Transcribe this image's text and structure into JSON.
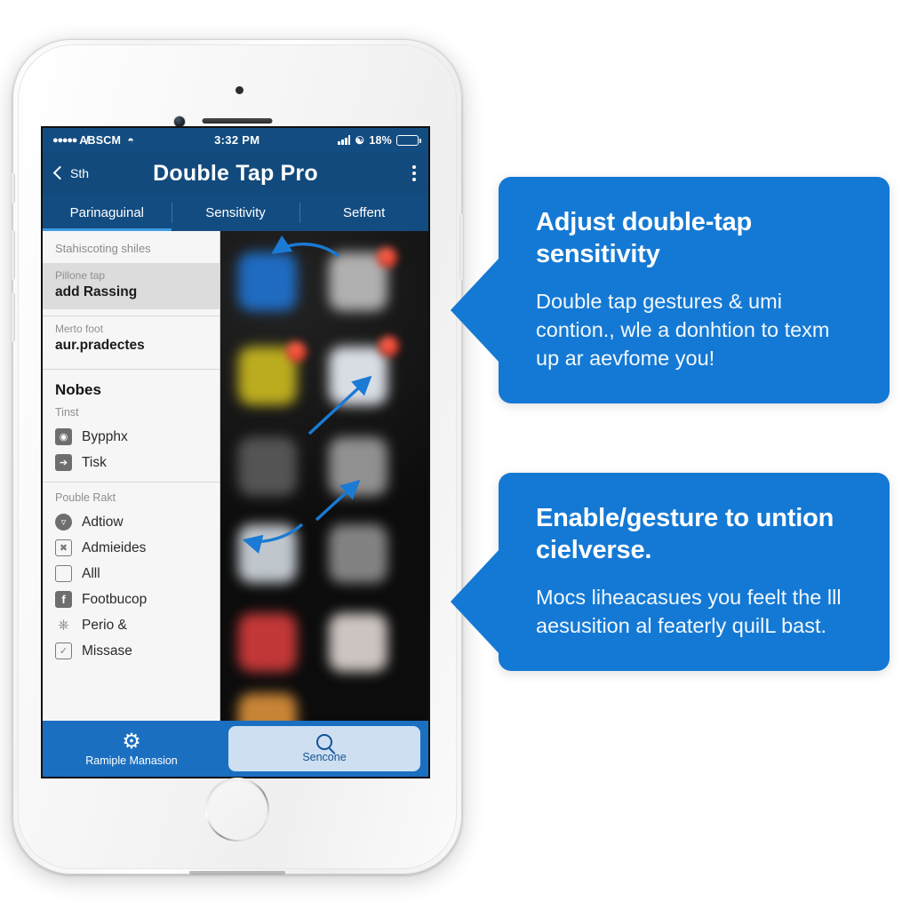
{
  "phone": {
    "status_bar": {
      "carrier_dots": "●●●●●",
      "carrier": "A̸BSCM",
      "wifi_icon": "wifi-icon",
      "time": "3:32 PM",
      "battery_percent": "18%",
      "battery_level": 18,
      "bluetooth_icon": "bluetooth-icon",
      "signal_icon": "signal-bars-icon"
    },
    "nav_bar": {
      "back_icon": "back-chevron-icon",
      "back_label": "Sth",
      "title": "Double Tap Pro",
      "overflow_icon": "overflow-menu-icon"
    },
    "tabs": [
      {
        "label": "Parinaguinal",
        "active": true
      },
      {
        "label": "Sensitivity",
        "active": false
      },
      {
        "label": "Seffent",
        "active": false
      }
    ],
    "sidebar": {
      "section_label": "Stahiscoting shiles",
      "selected_row": {
        "subtitle": "Pillone tap",
        "title": "add Rassing"
      },
      "second_row": {
        "subtitle": "Merto foot",
        "title": "aur.pradectes"
      },
      "heading": "Nobes",
      "heading_sub": "Tinst",
      "items_group_1": [
        {
          "label": "Bypphx",
          "icon": "photo-icon"
        },
        {
          "label": "Tisk",
          "icon": "note-icon"
        }
      ],
      "group_2_label": "Pouble Rakt",
      "items_group_2": [
        {
          "label": "Adtiow",
          "icon": "envelope-icon"
        },
        {
          "label": "Admieides",
          "icon": "scissors-icon"
        },
        {
          "label": "Alll",
          "icon": "monitor-icon"
        },
        {
          "label": "Footbucop",
          "icon": "facebook-icon"
        },
        {
          "label": "Perio &",
          "icon": "microphone-icon"
        },
        {
          "label": "Missase",
          "icon": "checkbox-icon"
        }
      ]
    },
    "app_grid": {
      "description": "blurred dark home screen app icon grid with notification badges",
      "arrows": [
        "curved-arrow-left-top",
        "straight-arrow-up-right",
        "straight-arrow-up-right-lower",
        "curved-arrow-left-bottom"
      ]
    },
    "bottom_bar": {
      "settings_icon": "gear-icon",
      "settings_label": "Ramiple Manasion",
      "search_icon": "search-icon",
      "search_label": "Sencone"
    }
  },
  "callouts": [
    {
      "title": "Adjust double-tap sensitivity",
      "body": "Double tap gestures & umi contion., wle a donhtion to texm up ar aevfome you!"
    },
    {
      "title": "Enable/gesture to untion cielverse.",
      "body": "Mocs liheacasues you feelt the lll aesusition al featerly quilL bast."
    }
  ],
  "colors": {
    "callout_blue": "#1479d4",
    "nav_navy": "#124a7d",
    "status_navy": "#134c80",
    "toolbar_blue": "#1b6fc0",
    "tab_indicator": "#3d9ce0",
    "sidebar_bg": "#f6f6f6",
    "selected_row": "#dcdcdc",
    "badge_red": "#d32414"
  }
}
